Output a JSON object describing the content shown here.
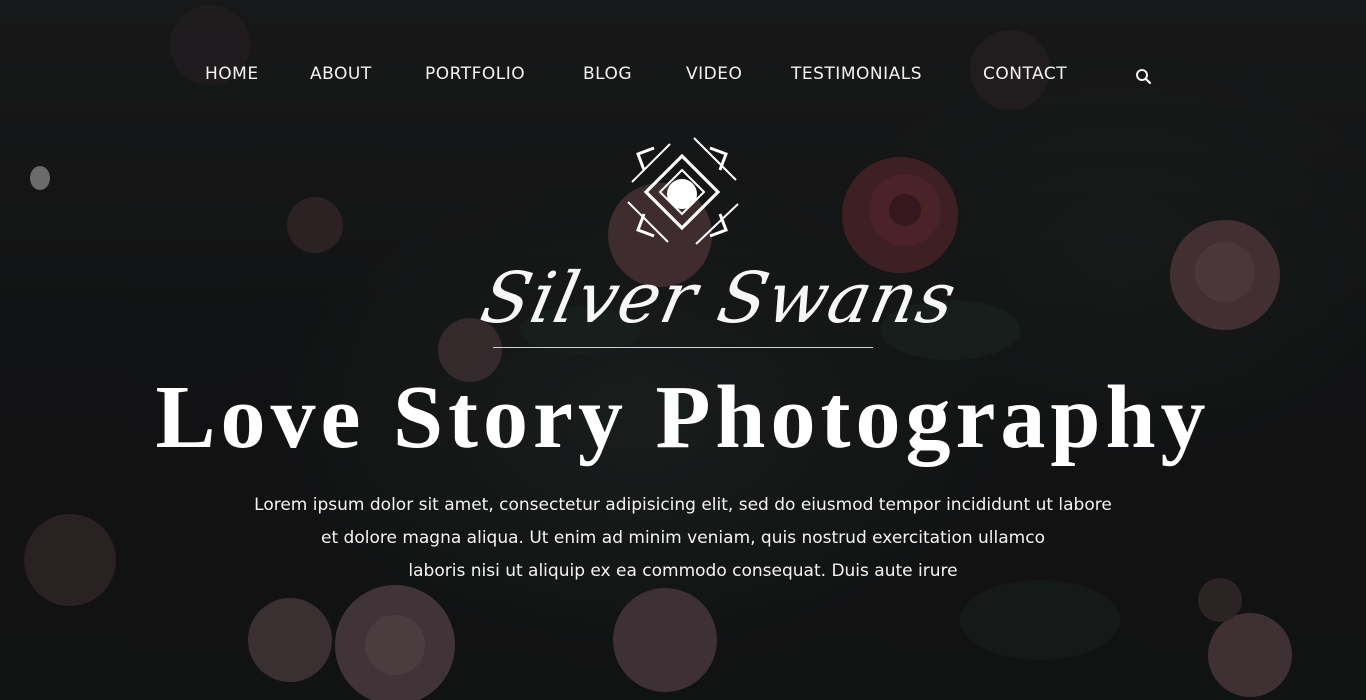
{
  "nav": {
    "items": [
      {
        "label": "HOME"
      },
      {
        "label": "ABOUT"
      },
      {
        "label": "PORTFOLIO"
      },
      {
        "label": "BLOG"
      },
      {
        "label": "VIDEO"
      },
      {
        "label": "TESTIMONIALS"
      },
      {
        "label": "CONTACT"
      }
    ],
    "search_icon": "search-icon"
  },
  "hero": {
    "logo_icon": "camera-lens-diamond-icon",
    "brand": "Silver Swans",
    "headline": "Love Story Photography",
    "paragraph_lines": [
      "Lorem ipsum dolor sit amet, consectetur adipisicing elit, sed do eiusmod tempor incididunt ut labore",
      "et dolore magna aliqua. Ut enim ad minim veniam, quis nostrud exercitation ullamco",
      "laboris nisi ut aliquip ex ea commodo consequat. Duis aute irure"
    ]
  },
  "colors": {
    "background": "#161718",
    "text": "#ffffff",
    "rose": "#7a4a52",
    "deep_rose": "#6a2f36"
  }
}
